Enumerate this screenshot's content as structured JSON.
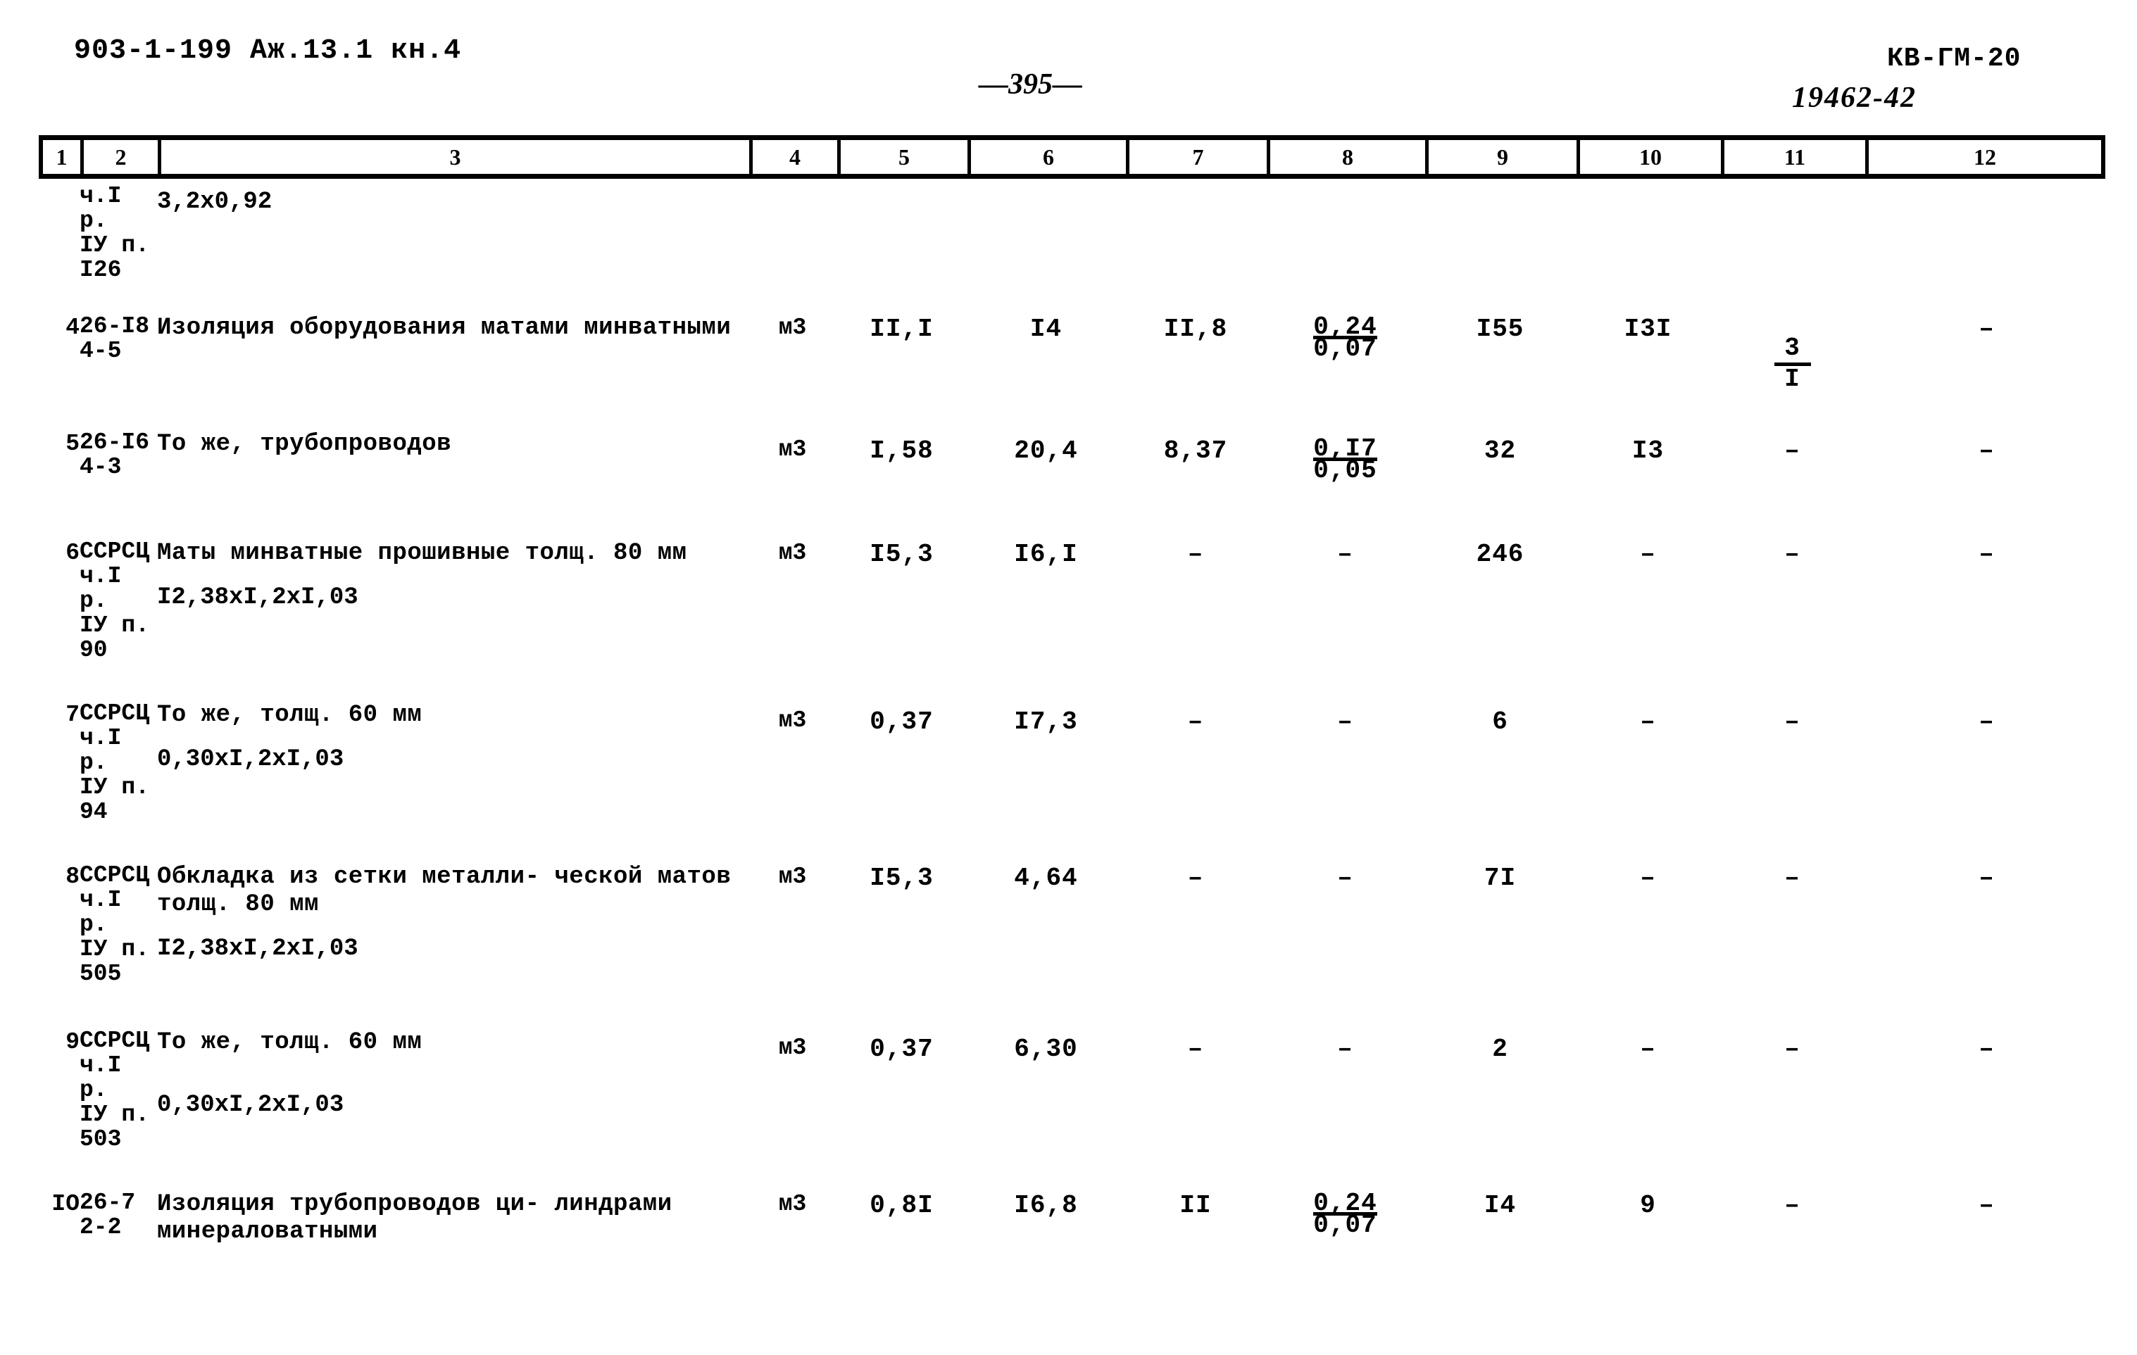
{
  "header": {
    "left_code": "903-1-199 Аж.13.1 кн.4",
    "page_number": "—395—",
    "doc_code": "КВ-ГМ-20",
    "stamp": "19462-42"
  },
  "table": {
    "column_headers": [
      "1",
      "2",
      "3",
      "4",
      "5",
      "6",
      "7",
      "8",
      "9",
      "10",
      "11",
      "12"
    ],
    "rows": [
      {
        "num": "",
        "code": "ч.I р.\nIУ п.\nI26",
        "desc": "",
        "dim": "3,2х0,92",
        "unit": "",
        "c5": "",
        "c6": "",
        "c7": "",
        "c8_top": "",
        "c8_bot": "",
        "c9": "",
        "c10": "",
        "c11_top": "",
        "c11_bot": "",
        "c12": ""
      },
      {
        "num": "4",
        "code": "26-I8\n4-5",
        "desc": "Изоляция оборудования матами минватными",
        "dim": "",
        "unit": "м3",
        "c5": "II,I",
        "c6": "I4",
        "c7": "II,8",
        "c8_top": "0,24",
        "c8_bot": "0,07",
        "c9": "I55",
        "c10": "I3I",
        "c11_top": "3",
        "c11_bot": "I",
        "c12": "–"
      },
      {
        "num": "5",
        "code": "26-I6\n4-3",
        "desc": "То же, трубопроводов",
        "dim": "",
        "unit": "м3",
        "c5": "I,58",
        "c6": "20,4",
        "c7": "8,37",
        "c8_top": "0,I7",
        "c8_bot": "0,05",
        "c9": "32",
        "c10": "I3",
        "c11_top": "–",
        "c11_bot": "",
        "c12": "–"
      },
      {
        "num": "6",
        "code": "ССРСЦ\nч.I р.\nIУ п.\n90",
        "desc": "Маты минватные прошивные толщ. 80 мм",
        "dim": "I2,38хI,2хI,03",
        "unit": "м3",
        "c5": "I5,3",
        "c6": "I6,I",
        "c7": "–",
        "c8_top": "–",
        "c8_bot": "",
        "c9": "246",
        "c10": "–",
        "c11_top": "–",
        "c11_bot": "",
        "c12": "–"
      },
      {
        "num": "7",
        "code": "ССРСЦ\nч.I р.\nIУ п.\n94",
        "desc": "То же, толщ. 60 мм",
        "dim": "0,30хI,2хI,03",
        "unit": "м3",
        "c5": "0,37",
        "c6": "I7,3",
        "c7": "–",
        "c8_top": "–",
        "c8_bot": "",
        "c9": "6",
        "c10": "–",
        "c11_top": "–",
        "c11_bot": "",
        "c12": "–"
      },
      {
        "num": "8",
        "code": "ССРСЦ\nч.I р.\nIУ п.\n505",
        "desc": "Обкладка из сетки металли- ческой матов толщ. 80 мм",
        "dim": "I2,38хI,2хI,03",
        "unit": "м3",
        "c5": "I5,3",
        "c6": "4,64",
        "c7": "–",
        "c8_top": "–",
        "c8_bot": "",
        "c9": "7I",
        "c10": "–",
        "c11_top": "–",
        "c11_bot": "",
        "c12": "–"
      },
      {
        "num": "9",
        "code": "ССРСЦ\nч.I р.\nIУ п.\n503",
        "desc": "То же, толщ. 60 мм",
        "dim": "0,30хI,2хI,03",
        "unit": "м3",
        "c5": "0,37",
        "c6": "6,30",
        "c7": "–",
        "c8_top": "–",
        "c8_bot": "",
        "c9": "2",
        "c10": "–",
        "c11_top": "–",
        "c11_bot": "",
        "c12": "–"
      },
      {
        "num": "IO",
        "code": "26-7\n2-2",
        "desc": "Изоляция трубопроводов ци- линдрами минераловатными",
        "dim": "",
        "unit": "м3",
        "c5": "0,8I",
        "c6": "I6,8",
        "c7": "II",
        "c8_top": "0,24",
        "c8_bot": "0,07",
        "c9": "I4",
        "c10": "9",
        "c11_top": "–",
        "c11_bot": "",
        "c12": "–"
      }
    ]
  }
}
